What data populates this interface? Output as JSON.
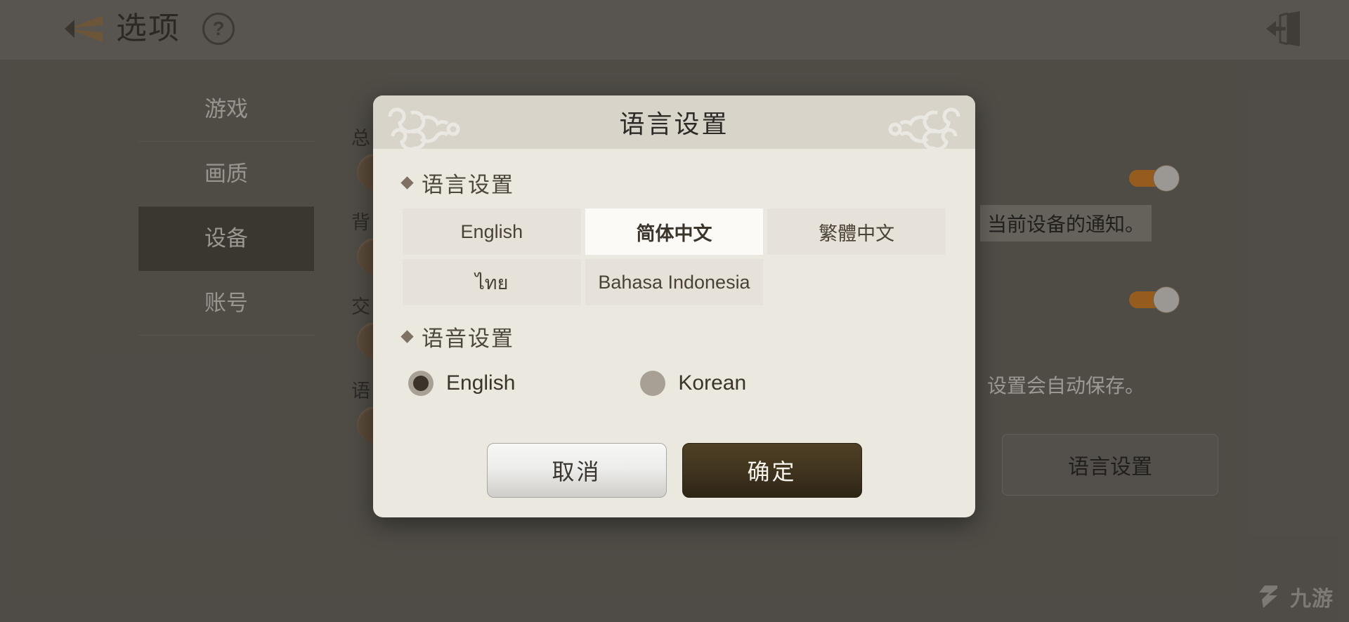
{
  "topbar": {
    "title": "选项",
    "help_label": "?",
    "back_icon": "back-arrow-icon",
    "exit_icon": "exit-door-icon"
  },
  "sidebar": {
    "items": [
      {
        "label": "游戏",
        "active": false
      },
      {
        "label": "画质",
        "active": false
      },
      {
        "label": "设备",
        "active": true
      },
      {
        "label": "账号",
        "active": false
      }
    ]
  },
  "background": {
    "row_labels": [
      "总",
      "背",
      "交",
      "语"
    ],
    "tooltip_notification": "当前设备的通知。",
    "tooltip_autosave": "设置会自动保存。",
    "language_button_label": "语言设置"
  },
  "modal": {
    "title": "语言设置",
    "language_section": {
      "heading": "语言设置",
      "options": [
        {
          "label": "English",
          "selected": false
        },
        {
          "label": "简体中文",
          "selected": true
        },
        {
          "label": "繁體中文",
          "selected": false
        },
        {
          "label": "ไทย",
          "selected": false
        },
        {
          "label": "Bahasa Indonesia",
          "selected": false
        }
      ]
    },
    "voice_section": {
      "heading": "语音设置",
      "options": [
        {
          "label": "English",
          "selected": true
        },
        {
          "label": "Korean",
          "selected": false
        }
      ]
    },
    "cancel_label": "取消",
    "confirm_label": "确定"
  },
  "watermark": {
    "text": "九游"
  },
  "colors": {
    "accent_orange": "#c4741c",
    "confirm_brown": "#40341f",
    "modal_bg": "#ebe8e0",
    "header_bg": "#d8d4ca",
    "selected_tab": "#433f39"
  }
}
